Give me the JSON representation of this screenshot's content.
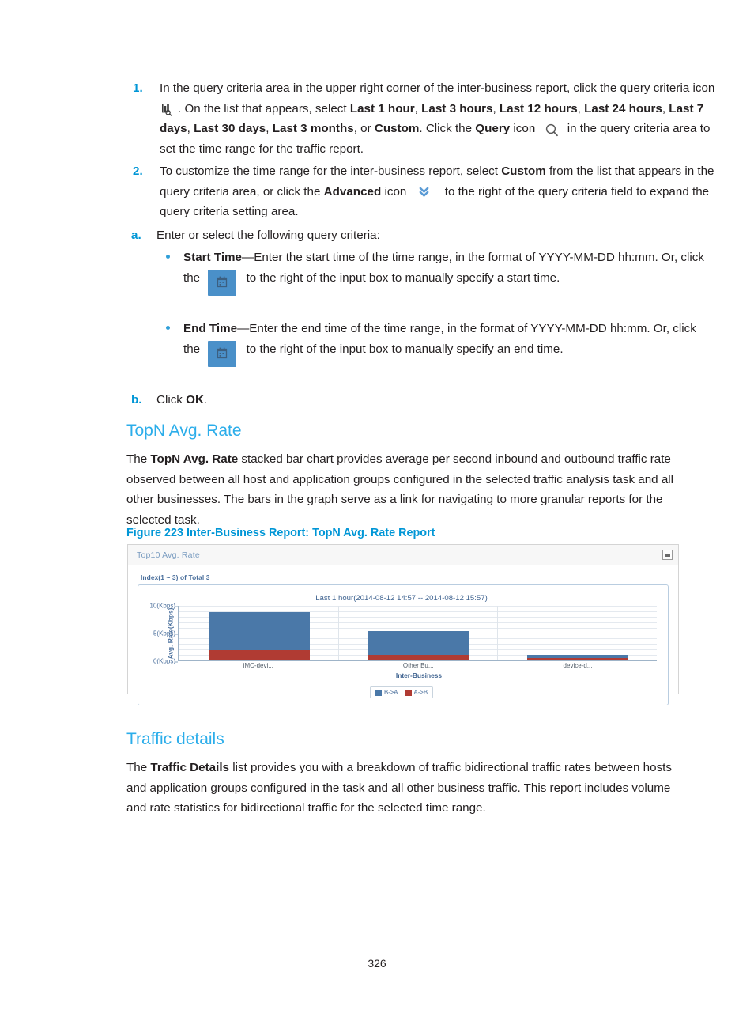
{
  "steps": [
    {
      "number": "1.",
      "parts": [
        {
          "t": "In the query criteria area in the upper right corner of the inter-business report, click the query criteria icon "
        },
        {
          "icon": "query-criteria-icon"
        },
        {
          "t": ". On the list that appears, select "
        },
        {
          "b": "Last 1 hour"
        },
        {
          "t": ", "
        },
        {
          "b": "Last 3 hours"
        },
        {
          "t": ", "
        },
        {
          "b": "Last 12 hours"
        },
        {
          "t": ", "
        },
        {
          "b": "Last 24 hours"
        },
        {
          "t": ", "
        },
        {
          "b": "Last 7 days"
        },
        {
          "t": ", "
        },
        {
          "b": "Last 30 days"
        },
        {
          "t": ", "
        },
        {
          "b": "Last 3 months"
        },
        {
          "t": ", or "
        },
        {
          "b": "Custom"
        },
        {
          "t": ". Click the "
        },
        {
          "b": "Query"
        },
        {
          "t": " icon "
        },
        {
          "icon": "search-icon"
        },
        {
          "t": " in the query criteria area to set the time range for the traffic report."
        }
      ]
    },
    {
      "number": "2.",
      "parts": [
        {
          "t": "To customize the time range for the inter-business report, select "
        },
        {
          "b": "Custom"
        },
        {
          "t": " from the list that appears in the query criteria area, or click the "
        },
        {
          "b": "Advanced"
        },
        {
          "t": " icon "
        },
        {
          "icon": "advanced-chevron-icon"
        },
        {
          "t": " to the right of the query criteria field to expand the query criteria setting area."
        }
      ]
    }
  ],
  "substep_a": {
    "letter": "a.",
    "text": "Enter or select the following query criteria:"
  },
  "bullets": [
    {
      "parts": [
        {
          "b": "Start Time"
        },
        {
          "t": "—Enter the start time of the time range, in the format of YYYY-MM-DD hh:mm. Or, click the "
        },
        {
          "b": "Calendar"
        },
        {
          "t": " icon "
        },
        {
          "icon": "calendar-icon"
        },
        {
          "t": " to the right of the input box to manually specify a start time."
        }
      ]
    },
    {
      "parts": [
        {
          "b": "End Time"
        },
        {
          "t": "—Enter the end time of the time range, in the format of YYYY-MM-DD hh:mm. Or, click the "
        },
        {
          "b": "Calendar"
        },
        {
          "t": " icon "
        },
        {
          "icon": "calendar-icon"
        },
        {
          "t": " to the right of the input box to manually specify an end time."
        }
      ]
    }
  ],
  "substep_b": {
    "letter": "b.",
    "parts": [
      {
        "t": "Click "
      },
      {
        "b": "OK"
      },
      {
        "t": "."
      }
    ]
  },
  "section_topn": {
    "title": "TopN Avg. Rate",
    "paragraph_parts": [
      {
        "t": "The "
      },
      {
        "b": "TopN Avg. Rate"
      },
      {
        "t": " stacked bar chart provides average per second inbound and outbound traffic rate observed between all host and application groups configured in the selected traffic analysis task and all other businesses. The bars in the graph serve as a link for navigating to more granular reports for the selected task."
      }
    ],
    "figure_caption": "Figure 223 Inter-Business Report: TopN Avg. Rate Report"
  },
  "widget": {
    "title": "Top10 Avg. Rate",
    "minimize_icon": "minimize-icon",
    "index_label": "Index(1 ~ 3) of Total 3"
  },
  "section_traffic": {
    "title": "Traffic details",
    "paragraph_parts": [
      {
        "t": "The "
      },
      {
        "b": "Traffic Details"
      },
      {
        "t": " list provides you with a breakdown of traffic bidirectional traffic rates between hosts and application groups configured in the task and all other business traffic. This report includes volume and rate statistics for bidirectional traffic for the selected time range."
      }
    ]
  },
  "footer": {
    "page_number": "326"
  },
  "colors": {
    "heading_blue": "#2badea",
    "caption_blue": "#0096d6",
    "list_number_blue": "#0096d6",
    "series_b_to_a": "#4a78a8",
    "series_a_to_b": "#b03b33",
    "widget_title": "#7a9cc0",
    "calendar_icon_bg": "#4a90c9"
  },
  "chart_data": {
    "type": "bar",
    "stacked": true,
    "title": "Last 1 hour(2014-08-12 14:57 -- 2014-08-12 15:57)",
    "xlabel": "Inter-Business",
    "ylabel": "Avg. Rate(Kbps)",
    "categories": [
      "iMC-devi...",
      "Other Bu...",
      "device-d..."
    ],
    "series": [
      {
        "name": "B->A",
        "color": "#4a78a8",
        "values": [
          6.9,
          4.4,
          0.5
        ]
      },
      {
        "name": "A->B",
        "color": "#b03b33",
        "values": [
          1.9,
          1.0,
          0.5
        ]
      }
    ],
    "totals": [
      8.8,
      5.4,
      1.0
    ],
    "ylim": [
      0,
      10
    ],
    "yticks": [
      0,
      5,
      10
    ],
    "ytick_labels": [
      "0(Kbps)",
      "5(Kbps)",
      "10(Kbps)"
    ],
    "grid": true,
    "legend_position": "bottom",
    "legend_entries": [
      "B->A",
      "A->B"
    ]
  }
}
